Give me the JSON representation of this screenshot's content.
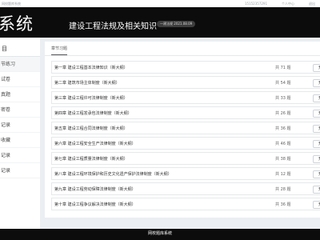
{
  "top_strip": {
    "site": "网校题库系统",
    "links": [
      "15152357291",
      "个人中心",
      "退出"
    ]
  },
  "header": {
    "brand": "系统",
    "course_title": "建设工程法规及相关知识",
    "version_badge": "一建法规 2021.08.09"
  },
  "sidebar": {
    "heading": "目",
    "items": [
      "节练习",
      "试卷",
      "真题",
      "密卷",
      "记录",
      "收藏",
      "记录",
      "记录"
    ],
    "active_index": 0
  },
  "main": {
    "tab_label": "章节习题",
    "open_label": "开始",
    "chapters": [
      {
        "title": "第一章 建设工程基本法律知识（新大纲）",
        "count": "共 71 题"
      },
      {
        "title": "第二章 建筑市场主体制度（新大纲）",
        "count": "共 54 题"
      },
      {
        "title": "第三章 建设工程许可法律制度（新大纲）",
        "count": "共 33 题"
      },
      {
        "title": "第四章 建设工程发承包法律制度（新大纲）",
        "count": "共 26 题"
      },
      {
        "title": "第五章 建设工程合同法律制度（新大纲）",
        "count": "共 36 题"
      },
      {
        "title": "第六章 建设工程安全生产法律制度（新大纲）",
        "count": "共 46 题"
      },
      {
        "title": "第七章 建设工程质量法律制度（新大纲）",
        "count": "共 38 题"
      },
      {
        "title": "第八章 建设工程环境保护和历史文化遗产保护法律制度（新大纲）",
        "count": "共 12 题"
      },
      {
        "title": "第九章 建设工程劳动保障法律制度（新大纲）",
        "count": "共 28 题"
      },
      {
        "title": "第十章 建设工程争议解决法律制度（新大纲）",
        "count": "共 36 题"
      }
    ]
  },
  "footer": {
    "text": "网校题库系统"
  }
}
